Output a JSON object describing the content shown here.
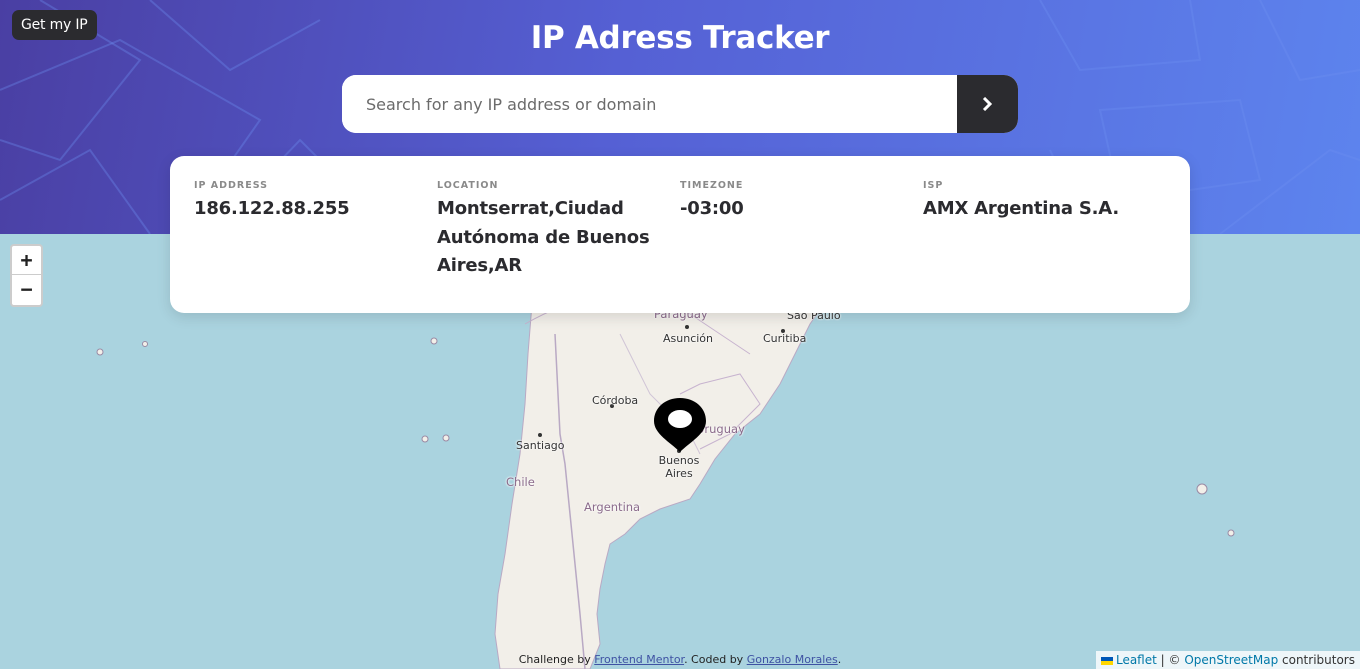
{
  "header": {
    "get_ip_label": "Get my IP",
    "title": "IP Adress Tracker",
    "search_placeholder": "Search for any IP address or domain",
    "search_value": ""
  },
  "info": {
    "ip": {
      "label": "IP ADDRESS",
      "value": "186.122.88.255"
    },
    "location": {
      "label": "LOCATION",
      "value": "Montserrat,Ciudad Autónoma de Buenos Aires,AR"
    },
    "timezone": {
      "label": "TIMEZONE",
      "value": "-03:00"
    },
    "isp": {
      "label": "ISP",
      "value": "AMX Argentina S.A."
    }
  },
  "map": {
    "zoom_in": "+",
    "zoom_out": "−",
    "labels": {
      "paraguay": "Paraguay",
      "sao_paulo": "São Paulo",
      "asuncion": "Asunción",
      "curitiba": "Curitiba",
      "cordoba": "Córdoba",
      "uruguay": "Uruguay",
      "santiago": "Santiago",
      "buenos_aires_1": "Buenos",
      "buenos_aires_2": "Aires",
      "chile": "Chile",
      "argentina": "Argentina"
    },
    "attribution": {
      "leaflet": "Leaflet",
      "separator": "| ©",
      "osm": "OpenStreetMap",
      "contributors": "contributors"
    }
  },
  "credit": {
    "prefix": "Challenge by",
    "frontend_mentor": "Frontend Mentor",
    "middle": ". Coded by",
    "author": "Gonzalo Morales",
    "suffix": "."
  },
  "colors": {
    "header_start": "#4a3fa3",
    "header_end": "#5d84ee",
    "dark": "#2b2b2f",
    "water": "#aad3df",
    "land": "#f2efe9"
  }
}
